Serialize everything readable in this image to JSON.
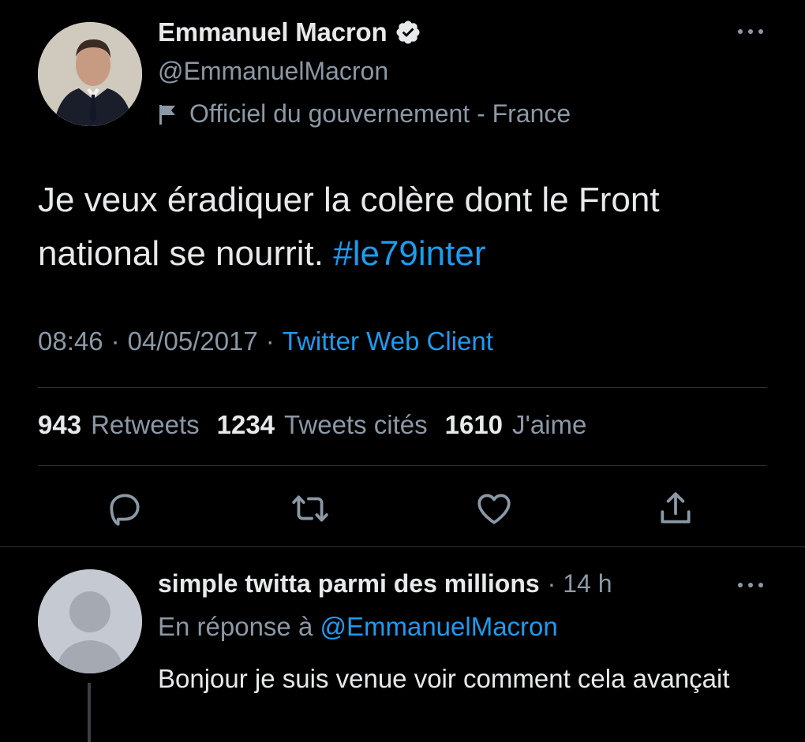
{
  "tweet": {
    "author": {
      "display_name": "Emmanuel Macron",
      "handle": "@EmmanuelMacron",
      "label": "Officiel du gouvernement - France",
      "verified": true,
      "avatar": "user-photo",
      "verified_icon": "verified-badge-icon",
      "label_icon": "flag-icon"
    },
    "text": "Je veux éradiquer la colère dont le Front national se nourrit.",
    "hashtag": "#le79inter",
    "time": "08:46",
    "date": "04/05/2017",
    "separator": "·",
    "client": "Twitter Web Client",
    "stats": {
      "retweets_count": "943",
      "retweets_label": "Retweets",
      "quotes_count": "1234",
      "quotes_label": "Tweets cités",
      "likes_count": "1610",
      "likes_label": "J'aime"
    },
    "actions": [
      "reply-icon",
      "retweet-icon",
      "like-icon",
      "share-icon"
    ],
    "more_icon": "more-options-icon"
  },
  "reply": {
    "display_name": "simple twitta parmi des millions",
    "time": "· 14 h",
    "reply_to_label": "En réponse à",
    "reply_to_handle": "@EmmanuelMacron",
    "text": "Bonjour je suis venue voir comment cela avançait",
    "avatar": "default-avatar",
    "more_icon": "more-options-icon"
  },
  "colors": {
    "background": "#000000",
    "text_primary": "#e7e9ea",
    "text_secondary": "#8b98a5",
    "accent": "#1d9bf0",
    "divider": "#2f3336"
  }
}
